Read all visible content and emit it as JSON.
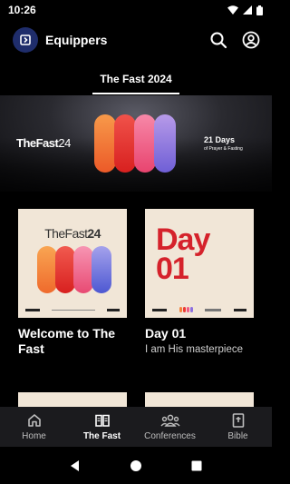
{
  "status_bar": {
    "time": "10:26",
    "icons": [
      "wifi-icon",
      "signal-icon",
      "battery-icon"
    ]
  },
  "app_bar": {
    "title": "Equippers",
    "icons": [
      "app-logo-icon",
      "search-icon",
      "account-icon"
    ]
  },
  "tabs": [
    {
      "label": "The Fast 2024",
      "active": true
    }
  ],
  "banner": {
    "title_bold": "TheFast",
    "title_thin": "24",
    "days_title": "21 Days",
    "days_sub": "of Prayer & Fasting"
  },
  "cards": [
    {
      "title": "Welcome to The Fast",
      "subtitle": "",
      "art": {
        "brand_bold": "TheFast",
        "brand_num": "24"
      }
    },
    {
      "title": "Day 01",
      "subtitle": "I am His masterpiece",
      "art": {
        "day_word": "Day",
        "day_num": "01"
      }
    }
  ],
  "bottom_nav": [
    {
      "label": "Home",
      "icon": "home-icon",
      "active": false
    },
    {
      "label": "The Fast",
      "icon": "book-icon",
      "active": true
    },
    {
      "label": "Conferences",
      "icon": "group-icon",
      "active": false
    },
    {
      "label": "Bible",
      "icon": "bible-icon",
      "active": false
    }
  ],
  "colors": {
    "background": "#000000",
    "card_art": "#f1e6d7",
    "day_red": "#d5222b",
    "nav_bg": "#1b1b1e",
    "pill_orange": "#f4823a",
    "pill_red": "#ec3b34",
    "pill_pink": "#f15c86",
    "pill_purple": "#8d6fe0"
  }
}
